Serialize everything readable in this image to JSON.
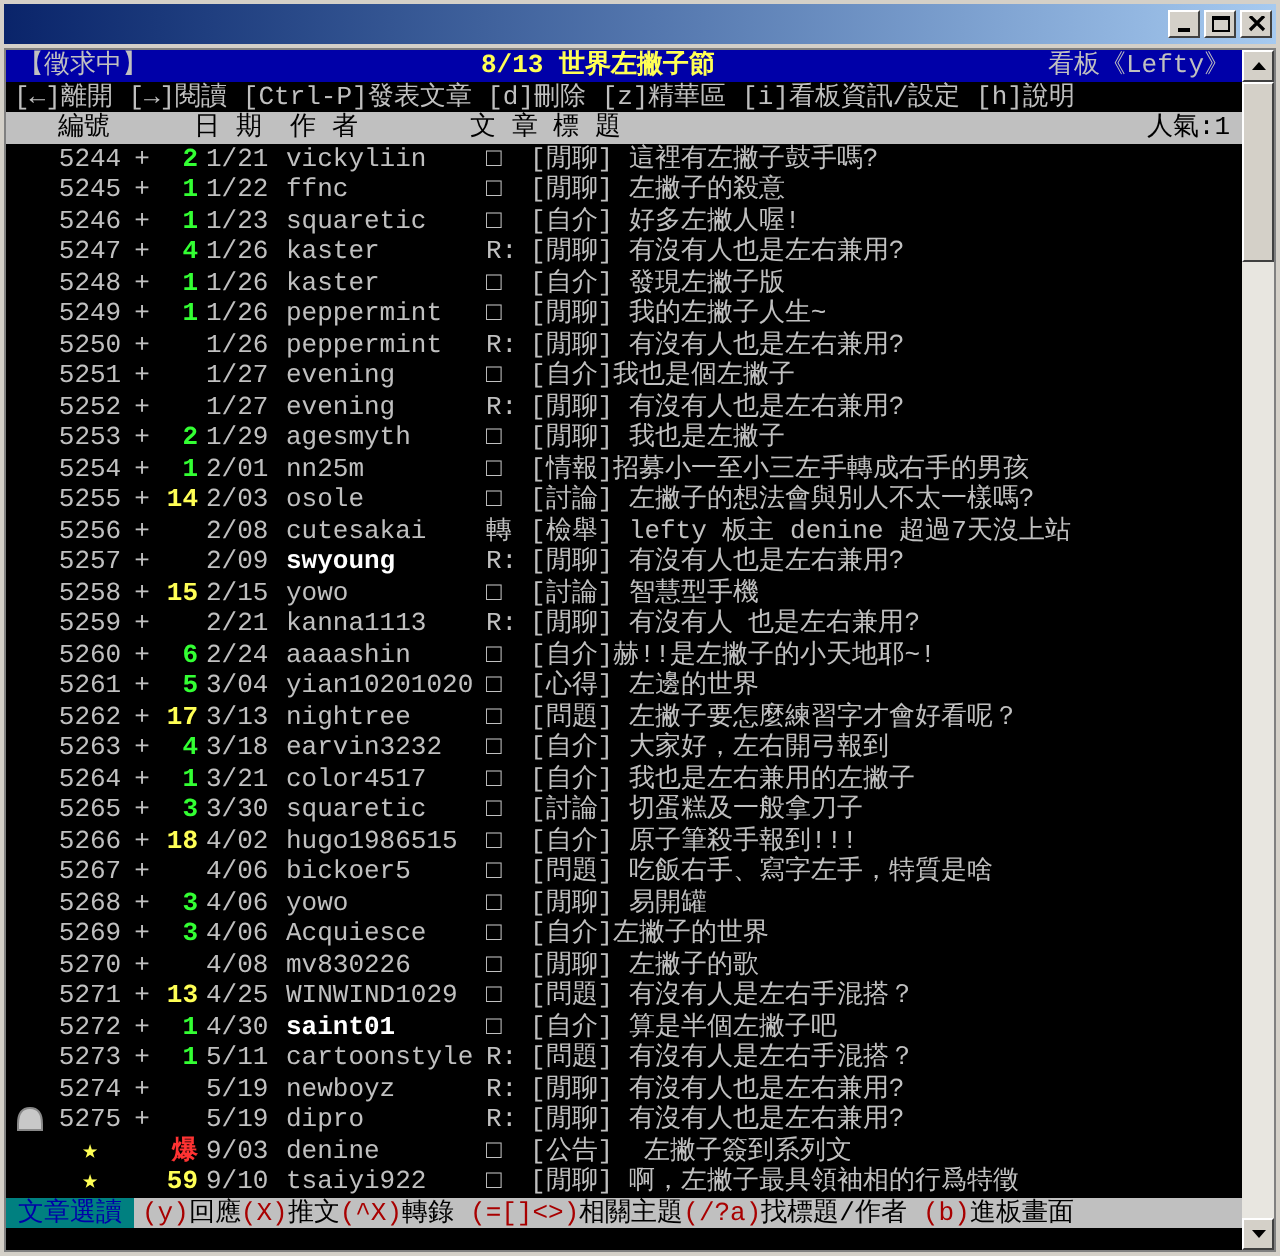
{
  "board_header": {
    "status": "【徵求中】",
    "event": "8/13 世界左撇子節",
    "board": "看板《Lefty》"
  },
  "help_line": "[←]離開 [→]閱讀 [Ctrl-P]發表文章 [d]刪除 [z]精華區 [i]看板資訊/設定 [h]說明",
  "columns": {
    "number": "編號",
    "date": "日 期",
    "author": "作 者",
    "title": "文 章 標 題",
    "popularity": "人氣:1"
  },
  "rows": [
    {
      "number": "5244",
      "plus": "+",
      "score": "2",
      "kind": "normal",
      "date": "1/21",
      "author": "vickyliin",
      "mark": "□",
      "subject": "[閒聊] 這裡有左撇子鼓手嗎?",
      "selected": false,
      "pinned": false,
      "author_bright": false
    },
    {
      "number": "5245",
      "plus": "+",
      "score": "1",
      "kind": "normal",
      "date": "1/22",
      "author": "ffnc",
      "mark": "□",
      "subject": "[閒聊] 左撇子的殺意",
      "selected": false,
      "pinned": false,
      "author_bright": false
    },
    {
      "number": "5246",
      "plus": "+",
      "score": "1",
      "kind": "normal",
      "date": "1/23",
      "author": "squaretic",
      "mark": "□",
      "subject": "[自介] 好多左撇人喔!",
      "selected": false,
      "pinned": false,
      "author_bright": false
    },
    {
      "number": "5247",
      "plus": "+",
      "score": "4",
      "kind": "normal",
      "date": "1/26",
      "author": "kaster",
      "mark": "R:",
      "subject": "[閒聊] 有沒有人也是左右兼用?",
      "selected": false,
      "pinned": false,
      "author_bright": false
    },
    {
      "number": "5248",
      "plus": "+",
      "score": "1",
      "kind": "normal",
      "date": "1/26",
      "author": "kaster",
      "mark": "□",
      "subject": "[自介] 發現左撇子版",
      "selected": false,
      "pinned": false,
      "author_bright": false
    },
    {
      "number": "5249",
      "plus": "+",
      "score": "1",
      "kind": "normal",
      "date": "1/26",
      "author": "peppermint",
      "mark": "□",
      "subject": "[閒聊] 我的左撇子人生~",
      "selected": false,
      "pinned": false,
      "author_bright": false
    },
    {
      "number": "5250",
      "plus": "+",
      "date": "1/26",
      "author": "peppermint",
      "mark": "R:",
      "subject": "[閒聊] 有沒有人也是左右兼用?",
      "selected": false,
      "pinned": false,
      "author_bright": false
    },
    {
      "number": "5251",
      "plus": "+",
      "date": "1/27",
      "author": "evening",
      "mark": "□",
      "subject": "[自介]我也是個左撇子",
      "selected": false,
      "pinned": false,
      "author_bright": false
    },
    {
      "number": "5252",
      "plus": "+",
      "date": "1/27",
      "author": "evening",
      "mark": "R:",
      "subject": "[閒聊] 有沒有人也是左右兼用?",
      "selected": false,
      "pinned": false,
      "author_bright": false
    },
    {
      "number": "5253",
      "plus": "+",
      "score": "2",
      "kind": "normal",
      "date": "1/29",
      "author": "agesmyth",
      "mark": "□",
      "subject": "[閒聊] 我也是左撇子",
      "selected": false,
      "pinned": false,
      "author_bright": false
    },
    {
      "number": "5254",
      "plus": "+",
      "score": "1",
      "kind": "normal",
      "date": "2/01",
      "author": "nn25m",
      "mark": "□",
      "subject": "[情報]招募小一至小三左手轉成右手的男孩",
      "selected": false,
      "pinned": false,
      "author_bright": false
    },
    {
      "number": "5255",
      "plus": "+",
      "score": "14",
      "kind": "high",
      "date": "2/03",
      "author": "osole",
      "mark": "□",
      "subject": "[討論] 左撇子的想法會與別人不太一樣嗎?",
      "selected": false,
      "pinned": false,
      "author_bright": false
    },
    {
      "number": "5256",
      "plus": "+",
      "date": "2/08",
      "author": "cutesakai",
      "mark": "轉",
      "subject": "[檢舉] lefty 板主 denine 超過7天沒上站",
      "selected": false,
      "pinned": false,
      "author_bright": false
    },
    {
      "number": "5257",
      "plus": "+",
      "date": "2/09",
      "author": "swyoung",
      "mark": "R:",
      "subject": "[閒聊] 有沒有人也是左右兼用?",
      "selected": false,
      "pinned": false,
      "author_bright": true
    },
    {
      "number": "5258",
      "plus": "+",
      "score": "15",
      "kind": "high",
      "date": "2/15",
      "author": "yowo",
      "mark": "□",
      "subject": "[討論] 智慧型手機",
      "selected": false,
      "pinned": false,
      "author_bright": false
    },
    {
      "number": "5259",
      "plus": "+",
      "date": "2/21",
      "author": "kanna1113",
      "mark": "R:",
      "subject": "[閒聊] 有沒有人 也是左右兼用?",
      "selected": false,
      "pinned": false,
      "author_bright": false
    },
    {
      "number": "5260",
      "plus": "+",
      "score": "6",
      "kind": "normal",
      "date": "2/24",
      "author": "aaaashin",
      "mark": "□",
      "subject": "[自介]赫!!是左撇子的小天地耶~!",
      "selected": false,
      "pinned": false,
      "author_bright": false
    },
    {
      "number": "5261",
      "plus": "+",
      "score": "5",
      "kind": "normal",
      "date": "3/04",
      "author": "yian10201020",
      "mark": "□",
      "subject": "[心得] 左邊的世界",
      "selected": false,
      "pinned": false,
      "author_bright": false
    },
    {
      "number": "5262",
      "plus": "+",
      "score": "17",
      "kind": "high",
      "date": "3/13",
      "author": "nightree",
      "mark": "□",
      "subject": "[問題] 左撇子要怎麼練習字才會好看呢？",
      "selected": false,
      "pinned": false,
      "author_bright": false
    },
    {
      "number": "5263",
      "plus": "+",
      "score": "4",
      "kind": "normal",
      "date": "3/18",
      "author": "earvin3232",
      "mark": "□",
      "subject": "[自介] 大家好，左右開弓報到",
      "selected": false,
      "pinned": false,
      "author_bright": false
    },
    {
      "number": "5264",
      "plus": "+",
      "score": "1",
      "kind": "normal",
      "date": "3/21",
      "author": "color4517",
      "mark": "□",
      "subject": "[自介] 我也是左右兼用的左撇子",
      "selected": false,
      "pinned": false,
      "author_bright": false
    },
    {
      "number": "5265",
      "plus": "+",
      "score": "3",
      "kind": "normal",
      "date": "3/30",
      "author": "squaretic",
      "mark": "□",
      "subject": "[討論] 切蛋糕及一般拿刀子",
      "selected": false,
      "pinned": false,
      "author_bright": false
    },
    {
      "number": "5266",
      "plus": "+",
      "score": "18",
      "kind": "high",
      "date": "4/02",
      "author": "hugo1986515",
      "mark": "□",
      "subject": "[自介] 原子筆殺手報到!!!",
      "selected": false,
      "pinned": false,
      "author_bright": false
    },
    {
      "number": "5267",
      "plus": "+",
      "date": "4/06",
      "author": "bickoer5",
      "mark": "□",
      "subject": "[問題] 吃飯右手、寫字左手，特質是啥",
      "selected": false,
      "pinned": false,
      "author_bright": false
    },
    {
      "number": "5268",
      "plus": "+",
      "score": "3",
      "kind": "normal",
      "date": "4/06",
      "author": "yowo",
      "mark": "□",
      "subject": "[閒聊] 易開罐",
      "selected": false,
      "pinned": false,
      "author_bright": false
    },
    {
      "number": "5269",
      "plus": "+",
      "score": "3",
      "kind": "normal",
      "date": "4/06",
      "author": "Acquiesce",
      "mark": "□",
      "subject": "[自介]左撇子的世界",
      "selected": false,
      "pinned": false,
      "author_bright": false
    },
    {
      "number": "5270",
      "plus": "+",
      "date": "4/08",
      "author": "mv830226",
      "mark": "□",
      "subject": "[閒聊] 左撇子的歌",
      "selected": false,
      "pinned": false,
      "author_bright": false
    },
    {
      "number": "5271",
      "plus": "+",
      "score": "13",
      "kind": "high",
      "date": "4/25",
      "author": "WINWIND1029",
      "mark": "□",
      "subject": "[問題] 有沒有人是左右手混搭？",
      "selected": false,
      "pinned": false,
      "author_bright": false
    },
    {
      "number": "5272",
      "plus": "+",
      "score": "1",
      "kind": "normal",
      "date": "4/30",
      "author": "saint01",
      "mark": "□",
      "subject": "[自介] 算是半個左撇子吧",
      "selected": false,
      "pinned": false,
      "author_bright": true
    },
    {
      "number": "5273",
      "plus": "+",
      "score": "1",
      "kind": "normal",
      "date": "5/11",
      "author": "cartoonstyle",
      "mark": "R:",
      "subject": "[問題] 有沒有人是左右手混搭？",
      "selected": false,
      "pinned": false,
      "author_bright": false
    },
    {
      "number": "5274",
      "plus": "+",
      "date": "5/19",
      "author": "newboyz",
      "mark": "R:",
      "subject": "[閒聊] 有沒有人也是左右兼用?",
      "selected": false,
      "pinned": false,
      "author_bright": false
    },
    {
      "number": "5275",
      "plus": "+",
      "date": "5/19",
      "author": "dipro",
      "mark": "R:",
      "subject": "[閒聊] 有沒有人也是左右兼用?",
      "selected": true,
      "pinned": false,
      "author_bright": false
    },
    {
      "number": "★",
      "score": "爆",
      "kind": "hot",
      "date": "9/03",
      "author": "denine",
      "mark": "□",
      "subject": "[公告]  左撇子簽到系列文",
      "selected": false,
      "pinned": true,
      "author_bright": false
    },
    {
      "number": "★",
      "score": "59",
      "kind": "high",
      "date": "9/10",
      "author": "tsaiyi922",
      "mark": "□",
      "subject": "[閒聊] 啊，左撇子最具領袖相的行爲特徵",
      "selected": false,
      "pinned": true,
      "author_bright": false
    }
  ],
  "footer": {
    "mode": "文章選讀",
    "shortcuts": [
      {
        "key": "(y)",
        "label": "回應"
      },
      {
        "key": "(X)",
        "label": "推文"
      },
      {
        "key": "(^X)",
        "label": "轉錄"
      },
      {
        "key": "(=[]<>)",
        "label": "相關主題"
      },
      {
        "key": "(/?a)",
        "label": "找標題/作者"
      },
      {
        "key": "(b)",
        "label": "進板畫面"
      }
    ]
  }
}
